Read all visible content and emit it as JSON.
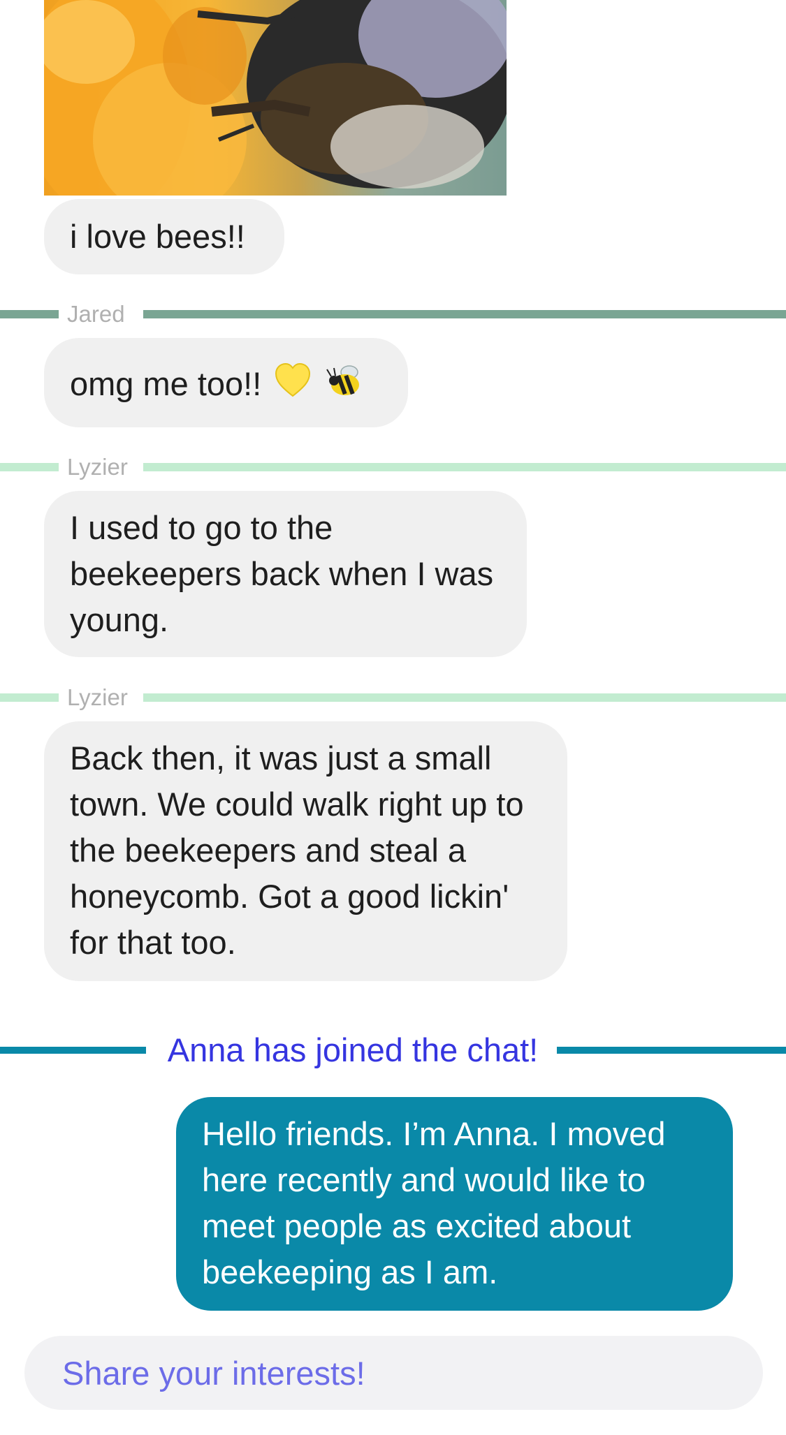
{
  "messages": {
    "m1": {
      "text": "i love bees!!"
    },
    "m2": {
      "text": "omg me too!!"
    },
    "m3": {
      "text": "I used to go to the beekeepers back when I was young."
    },
    "m4": {
      "text": "Back then, it was just a small town. We could walk right up to the beekeepers and steal a honeycomb. Got a good lickin' for that too."
    },
    "mine": {
      "text": "Hello friends. I’m Anna. I moved here recently and would like to meet people as excited about beekeeping as I am."
    }
  },
  "senders": {
    "jared": "Jared",
    "lyzier": "Lyzier"
  },
  "system": {
    "join": "Anna has joined the chat!"
  },
  "composer": {
    "placeholder": "Share your interests!"
  },
  "icons": {
    "photo": "bee-on-flower-photo",
    "heart": "yellow-heart-icon",
    "bee": "bee-icon"
  },
  "colors": {
    "bubble_in": "#f0f0f0",
    "bubble_out": "#0a89a8",
    "jared_line": "#7aa593",
    "lyzier_line": "#c2ecd0",
    "join_text": "#3535e0",
    "placeholder": "#6c6ce8"
  }
}
